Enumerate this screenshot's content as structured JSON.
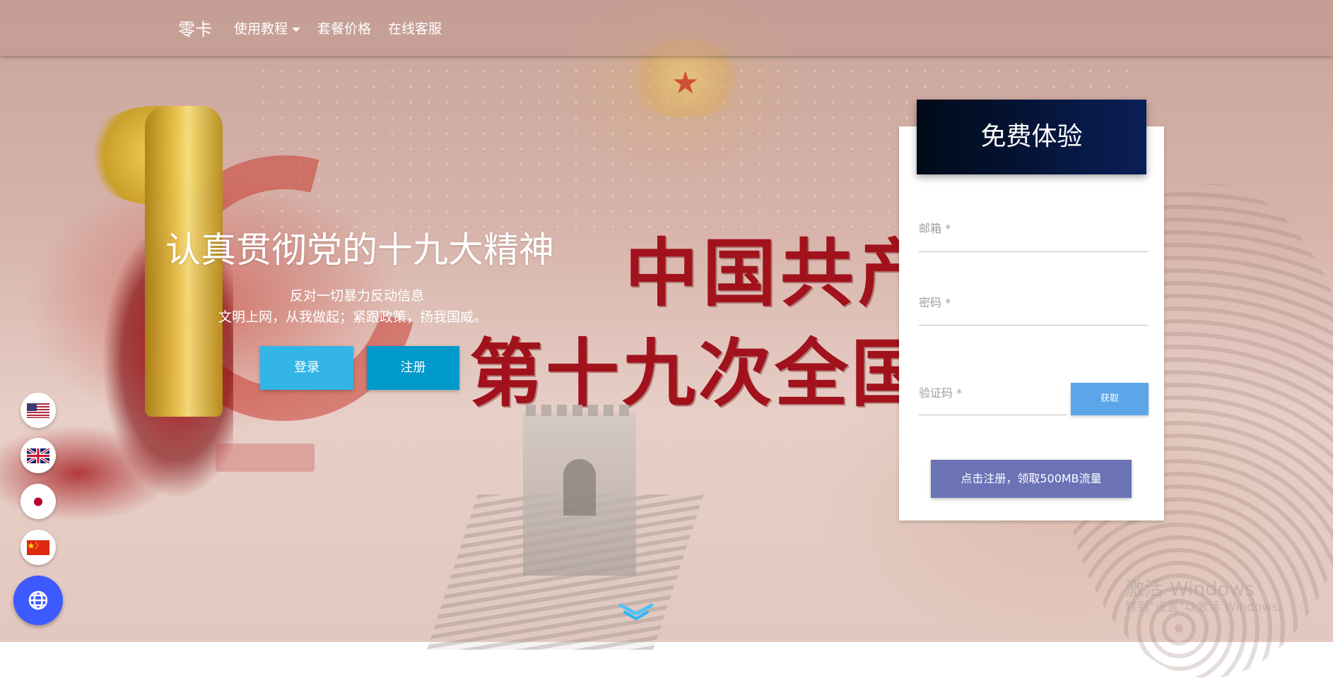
{
  "nav": {
    "brand": "零卡",
    "tutorial": "使用教程",
    "pricing": "套餐价格",
    "support": "在线客服"
  },
  "background": {
    "line1": "中国共产党",
    "line2": "第十九次全国代"
  },
  "hero": {
    "title": "认真贯彻党的十九大精神",
    "subtitle1": "反对一切暴力反动信息",
    "subtitle2": "文明上网，从我做起；紧跟政策，扬我国威。",
    "login": "登录",
    "register": "注册"
  },
  "form": {
    "header": "免费体验",
    "email_label": "邮箱 *",
    "password_label": "密码 *",
    "code_label": "验证码 *",
    "get_code": "获取",
    "submit": "点击注册，领取500MB流量"
  },
  "languages": [
    "us-flag-icon",
    "uk-flag-icon",
    "japan-flag-icon",
    "china-flag-icon"
  ],
  "watermark": {
    "title": "激活 Windows",
    "subtitle": "转到\"设置\"以激活 Windows。"
  },
  "colors": {
    "login_button": "#33b5e5",
    "register_button": "#0099cc",
    "submit_button": "#6b73b6",
    "get_button": "#5aa6e8",
    "globe_button": "#3d5afe"
  }
}
